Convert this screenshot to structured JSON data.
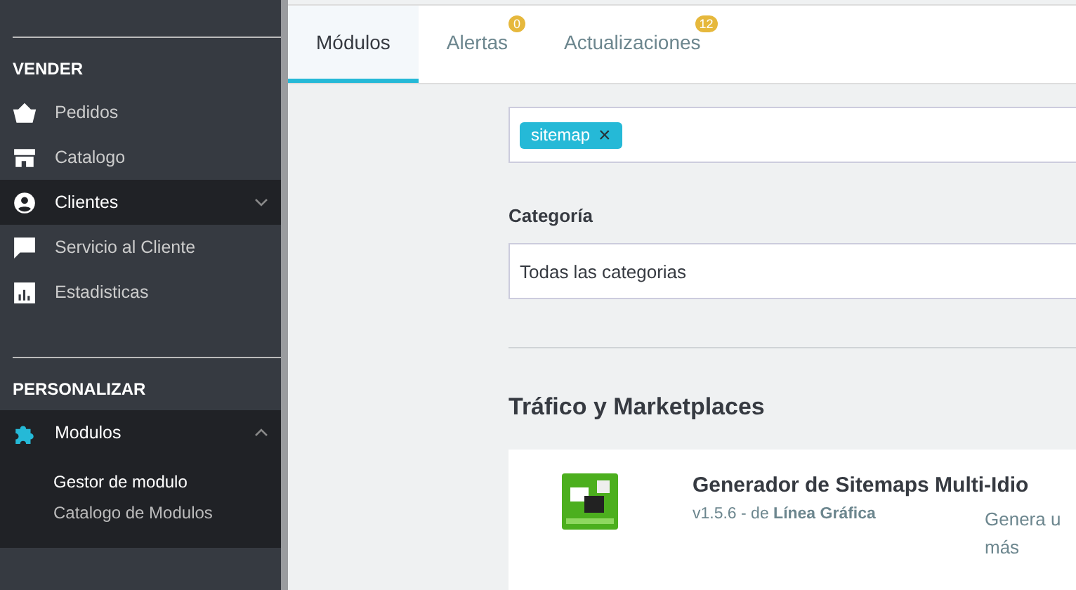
{
  "sidebar": {
    "sections": [
      {
        "title": "VENDER",
        "items": [
          {
            "label": "Pedidos",
            "selected": false
          },
          {
            "label": "Catalogo",
            "selected": false
          },
          {
            "label": "Clientes",
            "selected": true,
            "expanded": false
          },
          {
            "label": "Servicio al Cliente",
            "selected": false
          },
          {
            "label": "Estadisticas",
            "selected": false
          }
        ]
      },
      {
        "title": "PERSONALIZAR",
        "items": [
          {
            "label": "Modulos",
            "selected": true,
            "expanded": true,
            "children": [
              {
                "label": "Gestor de modulo",
                "selected": true
              },
              {
                "label": "Catalogo de Modulos",
                "selected": false
              }
            ]
          }
        ]
      }
    ]
  },
  "tabs": [
    {
      "label": "Módulos",
      "selected": true
    },
    {
      "label": "Alertas",
      "selected": false,
      "badge": "0"
    },
    {
      "label": "Actualizaciones",
      "selected": false,
      "badge": "12"
    }
  ],
  "search": {
    "tags": [
      "sitemap"
    ],
    "remove": "×"
  },
  "category": {
    "label": "Categoría",
    "value": "Todas las categorias"
  },
  "section_title": "Tráfico y Marketplaces",
  "module": {
    "name": "Generador de Sitemaps Multi-Idio",
    "meta": "v1.5.6 - de **Línea Gráfica**",
    "description_lines": [
      "Genera u",
      "más"
    ]
  }
}
